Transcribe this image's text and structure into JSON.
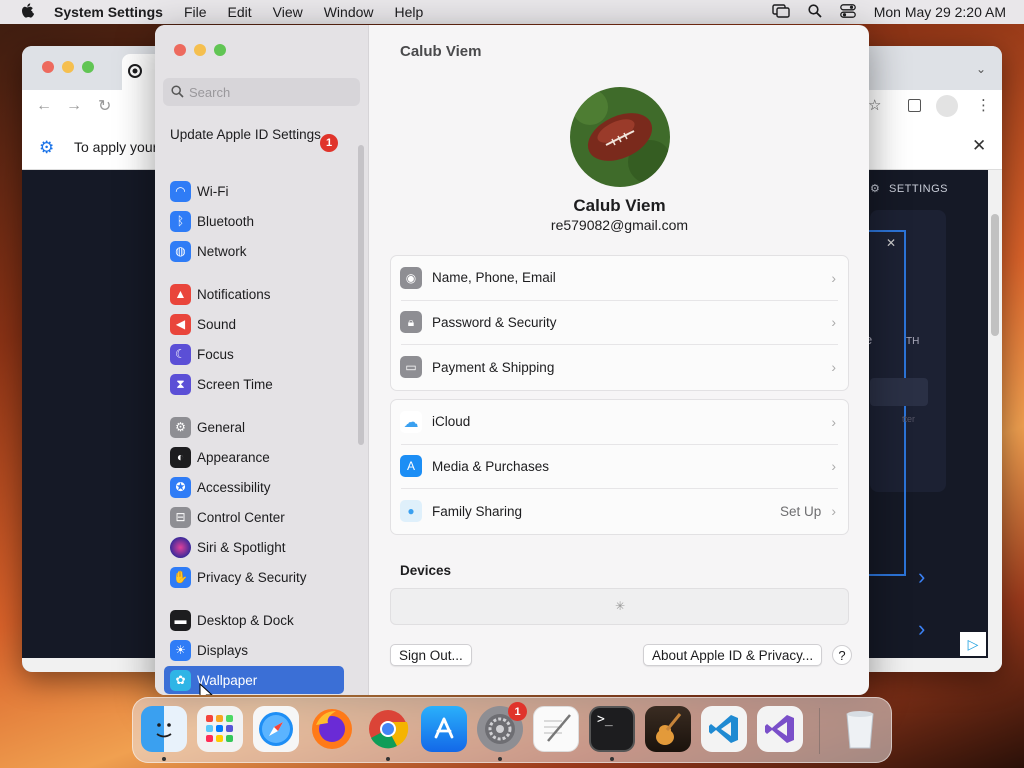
{
  "menubar": {
    "app_name": "System Settings",
    "menus": [
      "File",
      "Edit",
      "View",
      "Window",
      "Help"
    ],
    "datetime": "Mon May 29  2:20 AM"
  },
  "browser": {
    "infobar_text": "To apply your",
    "side_label": "SETTINGS",
    "partial_text_1": "TH",
    "partial_text_2": "e",
    "partial_text_3": "tter"
  },
  "settings": {
    "search_placeholder": "Search",
    "apple_id_row": "Update Apple ID Settings",
    "apple_id_badge": "1",
    "sidebar_items": [
      {
        "label": "Wi-Fi",
        "icon": "wifi-icon",
        "color": "#2f7cf6"
      },
      {
        "label": "Bluetooth",
        "icon": "bluetooth-icon",
        "color": "#2f7cf6"
      },
      {
        "label": "Network",
        "icon": "globe-icon",
        "color": "#2f7cf6"
      },
      {
        "label": "Notifications",
        "icon": "bell-icon",
        "color": "#e9453b"
      },
      {
        "label": "Sound",
        "icon": "speaker-icon",
        "color": "#e9453b"
      },
      {
        "label": "Focus",
        "icon": "moon-icon",
        "color": "#5b4fd6"
      },
      {
        "label": "Screen Time",
        "icon": "hourglass-icon",
        "color": "#5b4fd6"
      },
      {
        "label": "General",
        "icon": "gear-icon",
        "color": "#8e8e93"
      },
      {
        "label": "Appearance",
        "icon": "appearance-icon",
        "color": "#1d1d1f"
      },
      {
        "label": "Accessibility",
        "icon": "accessibility-icon",
        "color": "#2f7cf6"
      },
      {
        "label": "Control Center",
        "icon": "control-center-icon",
        "color": "#8e8e93"
      },
      {
        "label": "Siri & Spotlight",
        "icon": "siri-icon",
        "color": "#7a3fb0"
      },
      {
        "label": "Privacy & Security",
        "icon": "hand-icon",
        "color": "#2f7cf6"
      },
      {
        "label": "Desktop & Dock",
        "icon": "dock-icon",
        "color": "#1d1d1f"
      },
      {
        "label": "Displays",
        "icon": "sun-icon",
        "color": "#2f7cf6"
      },
      {
        "label": "Wallpaper",
        "icon": "wallpaper-icon",
        "color": "#2fb5e6"
      }
    ],
    "header_title": "Calub Viem",
    "profile": {
      "name": "Calub Viem",
      "email": "re579082@gmail.com"
    },
    "group1": [
      {
        "label": "Name, Phone, Email",
        "icon": "person-icon",
        "color": "#8e8e93"
      },
      {
        "label": "Password & Security",
        "icon": "lock-icon",
        "color": "#8e8e93"
      },
      {
        "label": "Payment & Shipping",
        "icon": "card-icon",
        "color": "#8e8e93"
      }
    ],
    "group2": [
      {
        "label": "iCloud",
        "icon": "cloud-icon",
        "color": "#ffffff",
        "value": ""
      },
      {
        "label": "Media & Purchases",
        "icon": "app-store-icon",
        "color": "#1c8ef5",
        "value": ""
      },
      {
        "label": "Family Sharing",
        "icon": "family-icon",
        "color": "#dff0fb",
        "value": "Set Up"
      }
    ],
    "devices_heading": "Devices",
    "sign_out": "Sign Out...",
    "about": "About Apple ID & Privacy...",
    "help": "?"
  },
  "dock": {
    "apps": [
      "Finder",
      "Launchpad",
      "Safari",
      "Firefox",
      "Google Chrome",
      "App Store",
      "System Settings",
      "TextEdit",
      "Terminal",
      "GarageBand",
      "Visual Studio Code",
      "Visual Studio",
      "Trash"
    ],
    "system_settings_badge": "1"
  }
}
